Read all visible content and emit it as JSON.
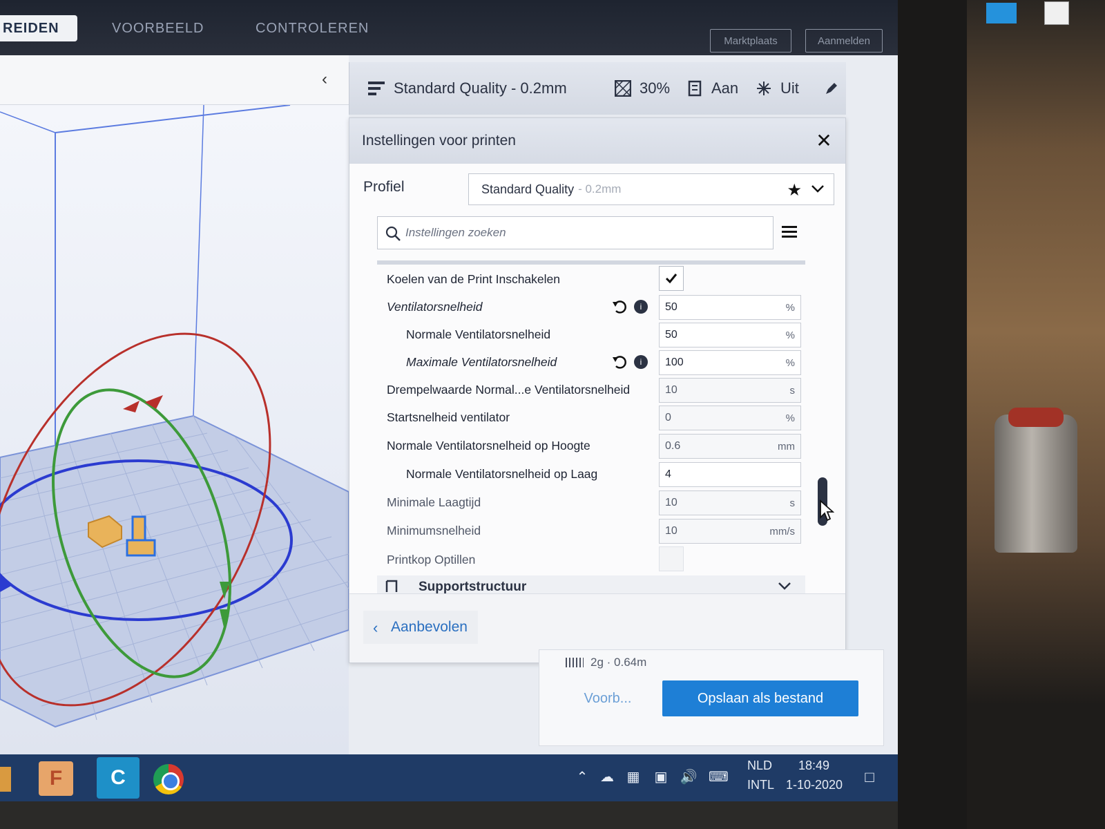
{
  "topbar": {
    "tabs": [
      "REIDEN",
      "VOORBEELD",
      "CONTROLEREN"
    ],
    "marketplace": "Marktplaats",
    "signin": "Aanmelden"
  },
  "settings_bar": {
    "profile": "Standard Quality - 0.2mm",
    "infill": "30%",
    "support": "Aan",
    "adhesion": "Uit"
  },
  "panel": {
    "title": "Instellingen voor printen",
    "profile_label": "Profiel",
    "profile_name": "Standard Quality",
    "profile_layer": "- 0.2mm",
    "search_placeholder": "Instellingen zoeken",
    "rows": [
      {
        "label": "Koelen van de Print Inschakelen",
        "type": "checkbox",
        "checked": true
      },
      {
        "label": "Ventilatorsnelheid",
        "value": "50",
        "unit": "%"
      },
      {
        "label": "Normale Ventilatorsnelheid",
        "value": "50",
        "unit": "%"
      },
      {
        "label": "Maximale Ventilatorsnelheid",
        "value": "100",
        "unit": "%"
      },
      {
        "label": "Drempelwaarde Normal...e Ventilatorsnelheid",
        "value": "10",
        "unit": "s"
      },
      {
        "label": "Startsnelheid ventilator",
        "value": "0",
        "unit": "%"
      },
      {
        "label": "Normale Ventilatorsnelheid op Hoogte",
        "value": "0.6",
        "unit": "mm"
      },
      {
        "label": "Normale Ventilatorsnelheid op Laag",
        "value": "4",
        "unit": ""
      },
      {
        "label": "Minimale Laagtijd",
        "value": "10",
        "unit": "s"
      },
      {
        "label": "Minimumsnelheid",
        "value": "10",
        "unit": "mm/s"
      },
      {
        "label": "Printkop Optillen",
        "type": "checkbox",
        "checked": false
      }
    ],
    "support_section": "Supportstructuur",
    "recommended": "Aanbevolen"
  },
  "action": {
    "estimate": "2g · 0.64m",
    "preview": "Voorb...",
    "save": "Opslaan als bestand"
  },
  "taskbar": {
    "lang1": "NLD",
    "lang2": "INTL",
    "time": "18:49",
    "date": "1-10-2020"
  }
}
